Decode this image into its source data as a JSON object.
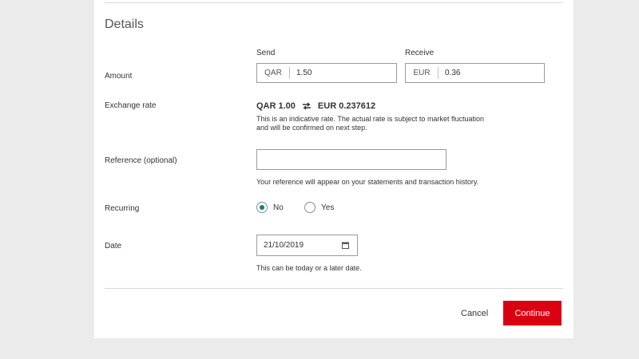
{
  "details": {
    "title": "Details",
    "amount": {
      "label": "Amount",
      "send_header": "Send",
      "receive_header": "Receive",
      "send_currency": "QAR",
      "send_value": "1.50",
      "receive_currency": "EUR",
      "receive_value": "0.36"
    },
    "exchange_rate": {
      "label": "Exchange rate",
      "from": "QAR 1.00",
      "to": "EUR 0.237612",
      "note_line1": "This is an indicative rate. The actual rate is subject to market fluctuation",
      "note_line2": "and will be confirmed on next step."
    },
    "reference": {
      "label": "Reference (optional)",
      "value": "",
      "hint": "Your reference will appear on your statements and transaction history."
    },
    "recurring": {
      "label": "Recurring",
      "options": [
        "No",
        "Yes"
      ],
      "selected": "No"
    },
    "date": {
      "label": "Date",
      "value": "21/10/2019",
      "hint": "This can be today or a later date."
    }
  },
  "actions": {
    "cancel_label": "Cancel",
    "continue_label": "Continue"
  },
  "colors": {
    "primary": "#db0011",
    "radio_selected": "#00847f",
    "background": "#ebebeb"
  },
  "icons": {
    "swap": "swap-arrows-icon",
    "calendar": "calendar-icon"
  }
}
